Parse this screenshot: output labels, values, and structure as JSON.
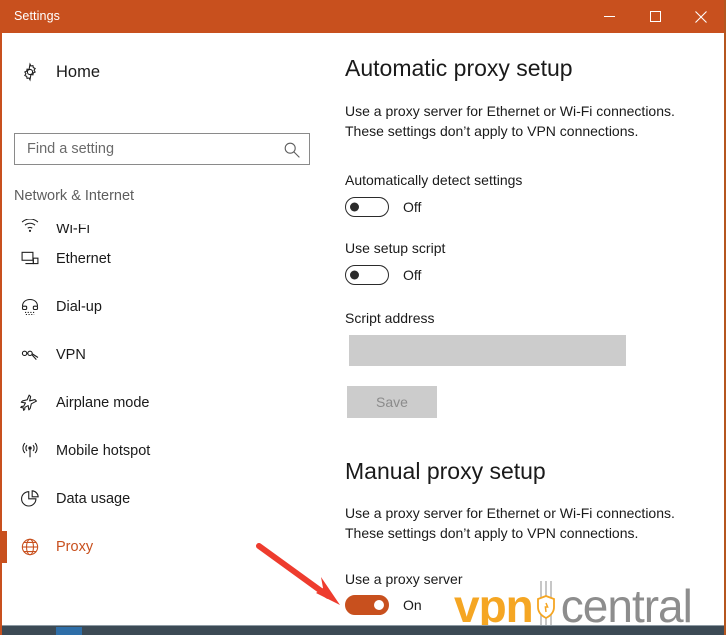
{
  "window": {
    "title": "Settings",
    "accent_color": "#c8501e",
    "controls": {
      "minimize": "minimize",
      "maximize": "maximize",
      "close": "close"
    }
  },
  "sidebar": {
    "home_label": "Home",
    "search": {
      "placeholder": "Find a setting",
      "value": ""
    },
    "category": "Network & Internet",
    "items": [
      {
        "label": "Wi-Fi",
        "icon": "wifi-icon",
        "selected": false,
        "clipped": true
      },
      {
        "label": "Ethernet",
        "icon": "ethernet-icon",
        "selected": false,
        "clipped": false
      },
      {
        "label": "Dial-up",
        "icon": "dialup-icon",
        "selected": false,
        "clipped": false
      },
      {
        "label": "VPN",
        "icon": "vpn-icon",
        "selected": false,
        "clipped": false
      },
      {
        "label": "Airplane mode",
        "icon": "airplane-icon",
        "selected": false,
        "clipped": false
      },
      {
        "label": "Mobile hotspot",
        "icon": "hotspot-icon",
        "selected": false,
        "clipped": false
      },
      {
        "label": "Data usage",
        "icon": "data-usage-icon",
        "selected": false,
        "clipped": false
      },
      {
        "label": "Proxy",
        "icon": "globe-icon",
        "selected": true,
        "clipped": false
      }
    ]
  },
  "main": {
    "automatic": {
      "title": "Automatic proxy setup",
      "description": "Use a proxy server for Ethernet or Wi-Fi connections. These settings don’t apply to VPN connections.",
      "auto_detect_label": "Automatically detect settings",
      "auto_detect_state": "Off",
      "setup_script_label": "Use setup script",
      "setup_script_state": "Off",
      "script_address_label": "Script address",
      "script_address_value": "",
      "save_label": "Save"
    },
    "manual": {
      "title": "Manual proxy setup",
      "description": "Use a proxy server for Ethernet or Wi-Fi connections. These settings don’t apply to VPN connections.",
      "use_proxy_label": "Use a proxy server",
      "use_proxy_state": "On"
    }
  },
  "annotation": {
    "arrow_color": "#ee3c2e"
  },
  "watermark": {
    "brand_first": "vpn",
    "brand_second": "central",
    "brand_first_color": "#f5a623",
    "brand_second_color": "#8d8d8d"
  }
}
